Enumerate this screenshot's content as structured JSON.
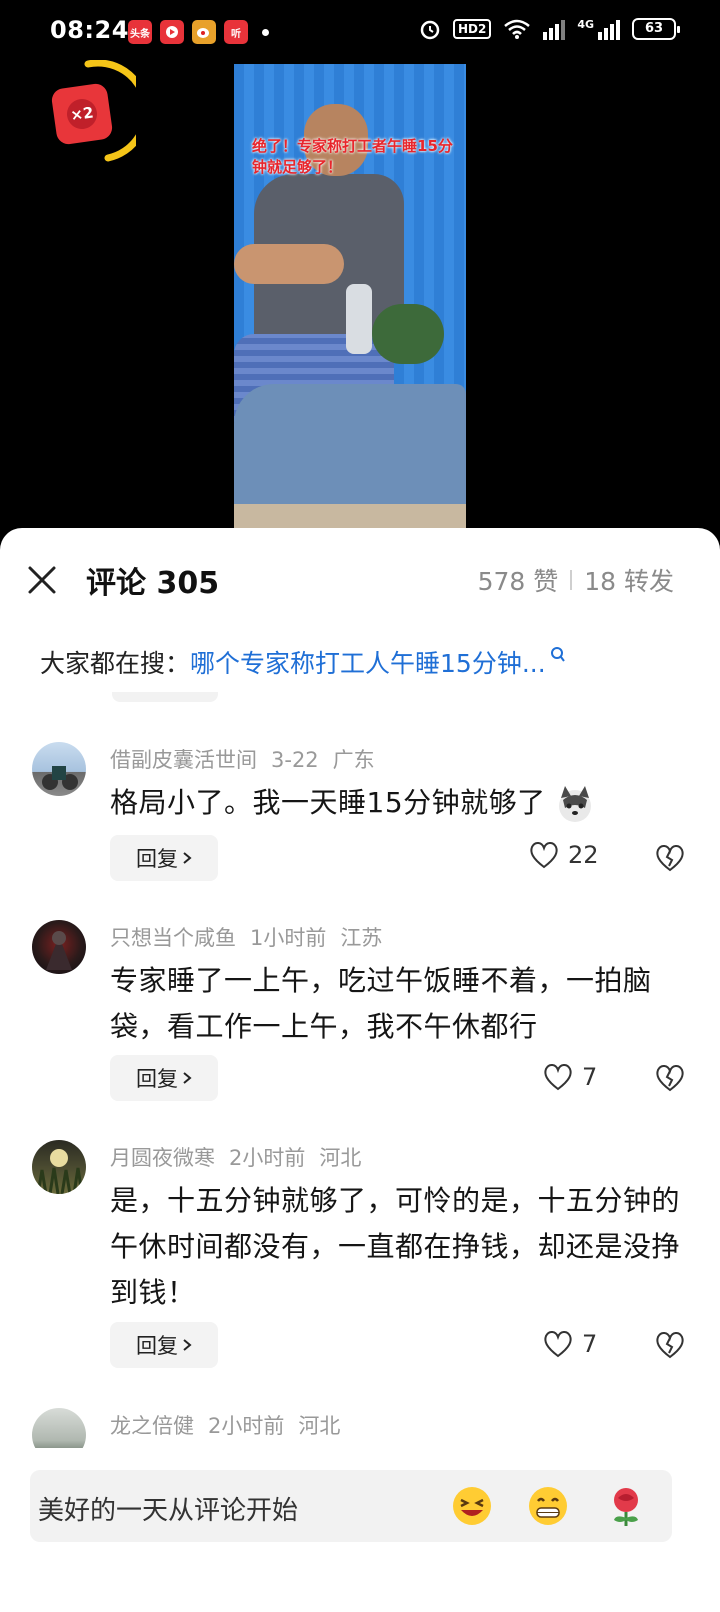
{
  "status_bar": {
    "time": "08:24",
    "apps": [
      {
        "icon": "toutiao-app-icon",
        "label": "头条",
        "color": "#e8333a"
      },
      {
        "icon": "video-app-icon",
        "label": "",
        "color": "#e8333a"
      },
      {
        "icon": "weibo-app-icon",
        "label": "",
        "color": "#e8a12a"
      },
      {
        "icon": "listen-app-icon",
        "label": "听",
        "color": "#e8333a"
      }
    ],
    "hd": "HD2",
    "network": "4G",
    "battery": "63"
  },
  "reward": {
    "label": "×2",
    "ring_progress": 0.35
  },
  "video": {
    "caption": "绝了！专家称打工者午睡15分钟就足够了！"
  },
  "panel": {
    "title": "评论 305",
    "likes": "578 赞",
    "shares": "18 转发",
    "search_label": "大家都在搜：",
    "search_link": "哪个专家称打工人午睡15分钟..."
  },
  "comments": [
    {
      "user": "借副皮囊活世间",
      "date": "3-22",
      "location": "广东",
      "text": "格局小了。我一天睡15分钟就够了",
      "reply_label": "回复",
      "likes": "22"
    },
    {
      "user": "只想当个咸鱼",
      "date": "1小时前",
      "location": "江苏",
      "text": "专家睡了一上午，吃过午饭睡不着，一拍脑袋，看工作一上午，我不午休都行",
      "reply_label": "回复",
      "likes": "7"
    },
    {
      "user": "月圆夜微寒",
      "date": "2小时前",
      "location": "河北",
      "text": "是，十五分钟就够了，可怜的是，十五分钟的午休时间都没有，一直都在挣钱，却还是没挣到钱！",
      "reply_label": "回复",
      "likes": "7"
    },
    {
      "user": "龙之倍健",
      "date": "2小时前",
      "location": "河北"
    }
  ],
  "input": {
    "placeholder": "美好的一天从评论开始",
    "emojis": [
      "grinning-squint-emoji",
      "grinning-teeth-emoji",
      "rose-emoji"
    ]
  }
}
